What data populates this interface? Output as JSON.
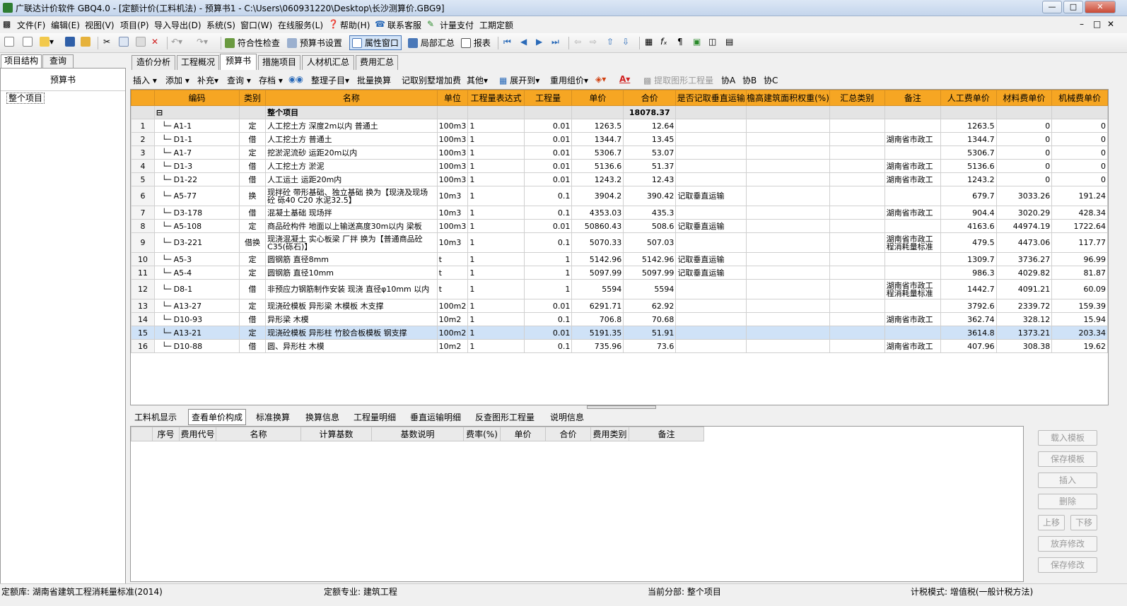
{
  "window": {
    "title": "广联达计价软件 GBQ4.0 - [定额计价(工料机法) - 预算书1 - C:\\Users\\060931220\\Desktop\\长沙测算价.GBG9]"
  },
  "menu": [
    "文件(F)",
    "编辑(E)",
    "视图(V)",
    "项目(P)",
    "导入导出(D)",
    "系统(S)",
    "窗口(W)",
    "在线服务(L)",
    "帮助(H)",
    "联系客服",
    "计量支付",
    "工期定额"
  ],
  "toolbar": {
    "check": "符合性检查",
    "settings": "预算书设置",
    "attr_window": "属性窗口",
    "local_summary": "局部汇总",
    "report": "报表"
  },
  "left": {
    "tabs": [
      "项目结构",
      "查询"
    ],
    "header": "预算书",
    "tree_item": "整个项目"
  },
  "main_tabs": [
    "造价分析",
    "工程概况",
    "预算书",
    "措施项目",
    "人材机汇总",
    "费用汇总"
  ],
  "subtoolbar": [
    "插入",
    "添加",
    "补充",
    "查询",
    "存档",
    "整理子目",
    "批量换算",
    "记取别墅增加费",
    "其他",
    "展开到",
    "重用组价",
    "提取图形工程量",
    "协A",
    "协B",
    "协C"
  ],
  "grid": {
    "headers": [
      "编码",
      "类别",
      "名称",
      "单位",
      "工程量表达式",
      "工程量",
      "单价",
      "合价",
      "是否记取垂直运输",
      "檐高建筑面积权重(%)",
      "汇总类别",
      "备注",
      "人工费单价",
      "材料费单价",
      "机械费单价"
    ],
    "root": {
      "name": "整个项目",
      "total": "18078.37"
    },
    "rows": [
      {
        "n": "1",
        "code": "A1-1",
        "type": "定",
        "name": "人工挖土方 深度2m以内 普通土",
        "unit": "100m3",
        "expr": "1",
        "qty": "0.01",
        "price": "1263.5",
        "total": "12.64",
        "vert": "",
        "note": "",
        "labor": "1263.5",
        "mat": "0",
        "mach": "0"
      },
      {
        "n": "2",
        "code": "D1-1",
        "type": "借",
        "name": "人工挖土方 普通土",
        "unit": "100m3",
        "expr": "1",
        "qty": "0.01",
        "price": "1344.7",
        "total": "13.45",
        "vert": "",
        "note": "湖南省市政工",
        "labor": "1344.7",
        "mat": "0",
        "mach": "0"
      },
      {
        "n": "3",
        "code": "A1-7",
        "type": "定",
        "name": "挖淤泥流砂 运距20m以内",
        "unit": "100m3",
        "expr": "1",
        "qty": "0.01",
        "price": "5306.7",
        "total": "53.07",
        "vert": "",
        "note": "",
        "labor": "5306.7",
        "mat": "0",
        "mach": "0"
      },
      {
        "n": "4",
        "code": "D1-3",
        "type": "借",
        "name": "人工挖土方 淤泥",
        "unit": "100m3",
        "expr": "1",
        "qty": "0.01",
        "price": "5136.6",
        "total": "51.37",
        "vert": "",
        "note": "湖南省市政工",
        "labor": "5136.6",
        "mat": "0",
        "mach": "0"
      },
      {
        "n": "5",
        "code": "D1-22",
        "type": "借",
        "name": "人工运土 运距20m内",
        "unit": "100m3",
        "expr": "1",
        "qty": "0.01",
        "price": "1243.2",
        "total": "12.43",
        "vert": "",
        "note": "湖南省市政工",
        "labor": "1243.2",
        "mat": "0",
        "mach": "0"
      },
      {
        "n": "6",
        "code": "A5-77",
        "type": "换",
        "name": "现拌砼 带形基础、独立基础  换为【现浇及现场砼 砾40 C20 水泥32.5】",
        "unit": "10m3",
        "expr": "1",
        "qty": "0.1",
        "price": "3904.2",
        "total": "390.42",
        "vert": "记取垂直运输",
        "note": "",
        "labor": "679.7",
        "mat": "3033.26",
        "mach": "191.24"
      },
      {
        "n": "7",
        "code": "D3-178",
        "type": "借",
        "name": "混凝土基础 现场拌",
        "unit": "10m3",
        "expr": "1",
        "qty": "0.1",
        "price": "4353.03",
        "total": "435.3",
        "vert": "",
        "note": "湖南省市政工",
        "labor": "904.4",
        "mat": "3020.29",
        "mach": "428.34"
      },
      {
        "n": "8",
        "code": "A5-108",
        "type": "定",
        "name": "商品砼构件 地面以上输送高度30m以内 梁板",
        "unit": "100m3",
        "expr": "1",
        "qty": "0.01",
        "price": "50860.43",
        "total": "508.6",
        "vert": "记取垂直运输",
        "note": "",
        "labor": "4163.6",
        "mat": "44974.19",
        "mach": "1722.64"
      },
      {
        "n": "9",
        "code": "D3-221",
        "type": "借换",
        "name": "现浇混凝土 实心板梁 厂拌  换为【普通商品砼 C35(砾石)】",
        "unit": "10m3",
        "expr": "1",
        "qty": "0.1",
        "price": "5070.33",
        "total": "507.03",
        "vert": "",
        "note": "湖南省市政工程消耗量标准",
        "labor": "479.5",
        "mat": "4473.06",
        "mach": "117.77"
      },
      {
        "n": "10",
        "code": "A5-3",
        "type": "定",
        "name": "圆钢筋 直径8mm",
        "unit": "t",
        "expr": "1",
        "qty": "1",
        "price": "5142.96",
        "total": "5142.96",
        "vert": "记取垂直运输",
        "note": "",
        "labor": "1309.7",
        "mat": "3736.27",
        "mach": "96.99"
      },
      {
        "n": "11",
        "code": "A5-4",
        "type": "定",
        "name": "圆钢筋 直径10mm",
        "unit": "t",
        "expr": "1",
        "qty": "1",
        "price": "5097.99",
        "total": "5097.99",
        "vert": "记取垂直运输",
        "note": "",
        "labor": "986.3",
        "mat": "4029.82",
        "mach": "81.87"
      },
      {
        "n": "12",
        "code": "D8-1",
        "type": "借",
        "name": "非预应力钢筋制作安装 现浇 直径φ10mm 以内",
        "unit": "t",
        "expr": "1",
        "qty": "1",
        "price": "5594",
        "total": "5594",
        "vert": "",
        "note": "湖南省市政工程消耗量标准",
        "labor": "1442.7",
        "mat": "4091.21",
        "mach": "60.09"
      },
      {
        "n": "13",
        "code": "A13-27",
        "type": "定",
        "name": "现浇砼模板 异形梁 木模板 木支撑",
        "unit": "100m2",
        "expr": "1",
        "qty": "0.01",
        "price": "6291.71",
        "total": "62.92",
        "vert": "",
        "note": "",
        "labor": "3792.6",
        "mat": "2339.72",
        "mach": "159.39"
      },
      {
        "n": "14",
        "code": "D10-93",
        "type": "借",
        "name": "异形梁 木模",
        "unit": "10m2",
        "expr": "1",
        "qty": "0.1",
        "price": "706.8",
        "total": "70.68",
        "vert": "",
        "note": "湖南省市政工",
        "labor": "362.74",
        "mat": "328.12",
        "mach": "15.94"
      },
      {
        "n": "15",
        "code": "A13-21",
        "type": "定",
        "name": "现浇砼模板 异形柱 竹胶合板模板 钢支撑",
        "unit": "100m2",
        "expr": "1",
        "qty": "0.01",
        "price": "5191.35",
        "total": "51.91",
        "vert": "",
        "note": "",
        "labor": "3614.8",
        "mat": "1373.21",
        "mach": "203.34"
      },
      {
        "n": "16",
        "code": "D10-88",
        "type": "借",
        "name": "圆、异形柱 木模",
        "unit": "10m2",
        "expr": "1",
        "qty": "0.1",
        "price": "735.96",
        "total": "73.6",
        "vert": "",
        "note": "湖南省市政工",
        "labor": "407.96",
        "mat": "308.38",
        "mach": "19.62"
      }
    ]
  },
  "bottom_tabs": [
    "工料机显示",
    "查看单价构成",
    "标准换算",
    "换算信息",
    "工程量明细",
    "垂直运输明细",
    "反查图形工程量",
    "说明信息"
  ],
  "bottom_headers": [
    "序号",
    "费用代号",
    "名称",
    "计算基数",
    "基数说明",
    "费率(%)",
    "单价",
    "合价",
    "费用类别",
    "备注"
  ],
  "side_buttons": [
    "载入模板",
    "保存模板",
    "插入",
    "删除",
    "上移",
    "下移",
    "放弃修改",
    "保存修改"
  ],
  "status": {
    "quota_lib": "定额库: 湖南省建筑工程消耗量标准(2014)",
    "quota_major": "定额专业: 建筑工程",
    "current": "当前分部: 整个项目",
    "tax": "计税模式: 增值税(一般计税方法)"
  }
}
